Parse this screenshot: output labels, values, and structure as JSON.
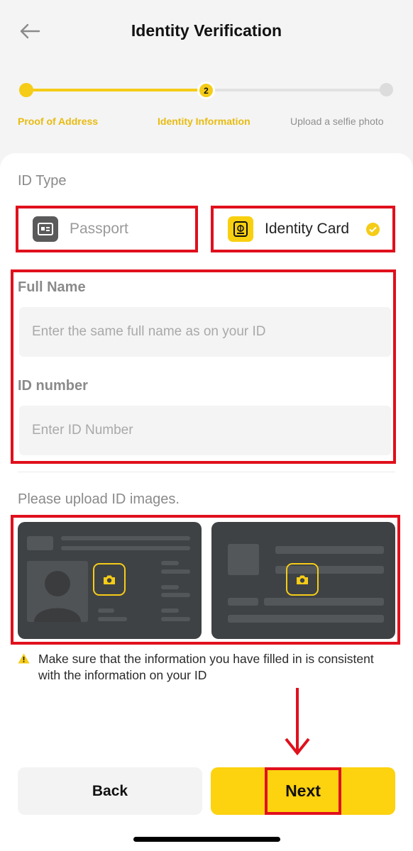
{
  "header": {
    "title": "Identity Verification"
  },
  "stepper": {
    "steps": [
      {
        "label": "Proof of Address",
        "status": "done"
      },
      {
        "label": "Identity Information",
        "status": "current",
        "number": "2"
      },
      {
        "label": "Upload a selfie photo",
        "status": "todo"
      }
    ]
  },
  "id_type": {
    "label": "ID Type",
    "options": [
      {
        "label": "Passport",
        "selected": false
      },
      {
        "label": "Identity Card",
        "selected": true
      }
    ]
  },
  "form": {
    "full_name_label": "Full Name",
    "full_name_placeholder": "Enter the same full name as on your ID",
    "id_number_label": "ID number",
    "id_number_placeholder": "Enter ID Number"
  },
  "upload": {
    "label": "Please upload ID images."
  },
  "notice": {
    "text": "Make sure that the information you have filled in is consistent with the information on your ID"
  },
  "buttons": {
    "back": "Back",
    "next": "Next"
  },
  "colors": {
    "accent": "#fdd20f",
    "highlight": "#e0101c"
  }
}
